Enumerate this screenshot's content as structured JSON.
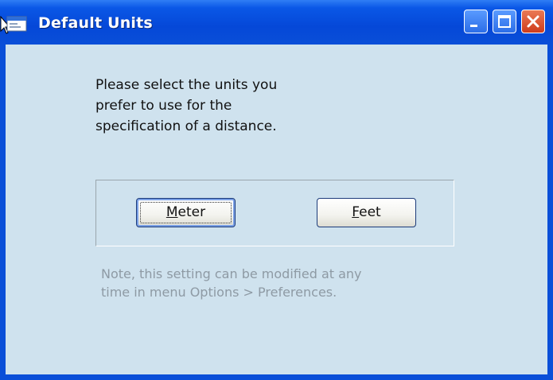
{
  "window": {
    "title": "Default Units"
  },
  "prompt": {
    "lines": [
      "Please select the units you",
      "prefer to use for the",
      "specification of a distance."
    ]
  },
  "buttons": {
    "meter": {
      "accel": "M",
      "rest": "eter"
    },
    "feet": {
      "accel": "F",
      "rest": "eet"
    }
  },
  "note": {
    "lines": [
      "Note, this setting can be modified at any",
      "time in menu Options > Preferences."
    ]
  },
  "colors": {
    "titlebar": "#0a4fd8",
    "client_background": "#cfe2ee",
    "note_text": "#8e9aa4",
    "close_button": "#cf3c1c"
  },
  "icons": {
    "app": "app-window-icon",
    "cursor": "mouse-pointer-icon",
    "minimize": "minimize-icon",
    "maximize": "maximize-icon",
    "close": "close-icon"
  }
}
